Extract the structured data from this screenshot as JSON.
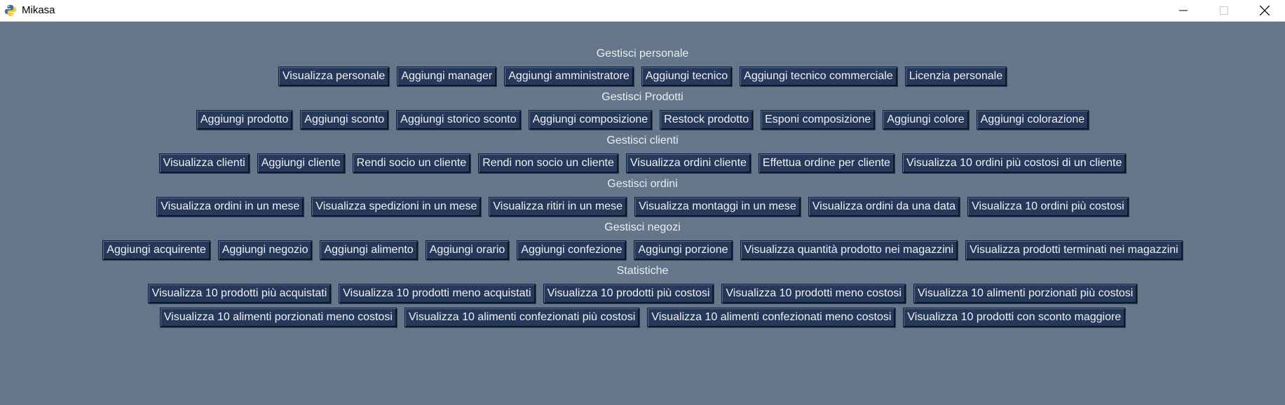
{
  "window": {
    "title": "Mikasa"
  },
  "sections": [
    {
      "title": "Gestisci personale",
      "buttons": [
        "Visualizza personale",
        "Aggiungi manager",
        "Aggiungi amministratore",
        "Aggiungi tecnico",
        "Aggiungi tecnico commerciale",
        "Licenzia personale"
      ]
    },
    {
      "title": "Gestisci Prodotti",
      "buttons": [
        "Aggiungi prodotto",
        "Aggiungi sconto",
        "Aggiungi storico sconto",
        "Aggiungi composizione",
        "Restock prodotto",
        "Esponi composizione",
        "Aggiungi colore",
        "Aggiungi colorazione"
      ]
    },
    {
      "title": "Gestisci clienti",
      "buttons": [
        "Visualizza clienti",
        "Aggiungi cliente",
        "Rendi socio un cliente",
        "Rendi non socio un cliente",
        "Visualizza ordini cliente",
        "Effettua ordine per cliente",
        "Visualizza 10 ordini più costosi di un cliente"
      ]
    },
    {
      "title": "Gestisci ordini",
      "buttons": [
        "Visualizza ordini in un mese",
        "Visualizza spedizioni in un mese",
        "Visualizza ritiri in un mese",
        "Visualizza montaggi in un mese",
        "Visualizza ordini da una data",
        "Visualizza 10 ordini più costosi"
      ]
    },
    {
      "title": "Gestisci negozi",
      "buttons": [
        "Aggiungi acquirente",
        "Aggiungi negozio",
        "Aggiungi alimento",
        "Aggiungi orario",
        "Aggiungi confezione",
        "Aggiungi porzione",
        "Visualizza quantità prodotto nei magazzini",
        "Visualizza prodotti terminati nei magazzini"
      ]
    },
    {
      "title": "Statistiche",
      "buttons": [
        "Visualizza 10 prodotti più acquistati",
        "Visualizza 10 prodotti meno acquistati",
        "Visualizza 10 prodotti più costosi",
        "Visualizza 10 prodotti meno costosi",
        "Visualizza 10 alimenti porzionati più costosi"
      ],
      "buttons2": [
        "Visualizza 10 alimenti porzionati meno costosi",
        "Visualizza 10 alimenti confezionati più costosi",
        "Visualizza 10 alimenti confezionati meno costosi",
        "Visualizza 10 prodotti con sconto maggiore"
      ]
    }
  ]
}
